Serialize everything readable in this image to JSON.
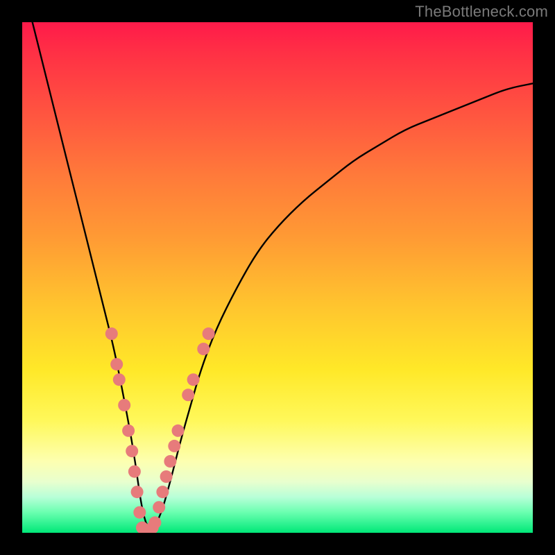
{
  "watermark": {
    "text": "TheBottleneck.com"
  },
  "chart_data": {
    "type": "line",
    "title": "",
    "xlabel": "",
    "ylabel": "",
    "xlim": [
      0,
      100
    ],
    "ylim": [
      0,
      100
    ],
    "legend": false,
    "grid": false,
    "background": "heat-gradient (red top → green bottom)",
    "series": [
      {
        "name": "curve",
        "stroke": "#000000",
        "x": [
          2,
          4,
          6,
          8,
          10,
          12,
          14,
          16,
          18,
          20,
          22,
          23.5,
          25,
          27,
          29,
          31,
          33,
          35,
          38,
          42,
          46,
          50,
          55,
          60,
          65,
          70,
          75,
          80,
          85,
          90,
          95,
          100
        ],
        "values": [
          100,
          92,
          84,
          76,
          68,
          60,
          52,
          44,
          36,
          26,
          15,
          4,
          0,
          3,
          10,
          18,
          25,
          32,
          40,
          48,
          55,
          60,
          65,
          69,
          73,
          76,
          79,
          81,
          83,
          85,
          87,
          88
        ]
      }
    ],
    "scatter": {
      "name": "data-points",
      "color": "#e77b7b",
      "points": [
        {
          "x": 17.5,
          "y": 39
        },
        {
          "x": 18.5,
          "y": 33
        },
        {
          "x": 19.0,
          "y": 30
        },
        {
          "x": 20.0,
          "y": 25
        },
        {
          "x": 20.8,
          "y": 20
        },
        {
          "x": 21.5,
          "y": 16
        },
        {
          "x": 22.0,
          "y": 12
        },
        {
          "x": 22.5,
          "y": 8
        },
        {
          "x": 23.0,
          "y": 4
        },
        {
          "x": 23.5,
          "y": 1
        },
        {
          "x": 24.0,
          "y": 0
        },
        {
          "x": 24.8,
          "y": 0
        },
        {
          "x": 25.5,
          "y": 1
        },
        {
          "x": 26.0,
          "y": 2
        },
        {
          "x": 26.8,
          "y": 5
        },
        {
          "x": 27.5,
          "y": 8
        },
        {
          "x": 28.2,
          "y": 11
        },
        {
          "x": 29.0,
          "y": 14
        },
        {
          "x": 29.8,
          "y": 17
        },
        {
          "x": 30.5,
          "y": 20
        },
        {
          "x": 32.5,
          "y": 27
        },
        {
          "x": 33.5,
          "y": 30
        },
        {
          "x": 35.5,
          "y": 36
        },
        {
          "x": 36.5,
          "y": 39
        }
      ]
    }
  }
}
